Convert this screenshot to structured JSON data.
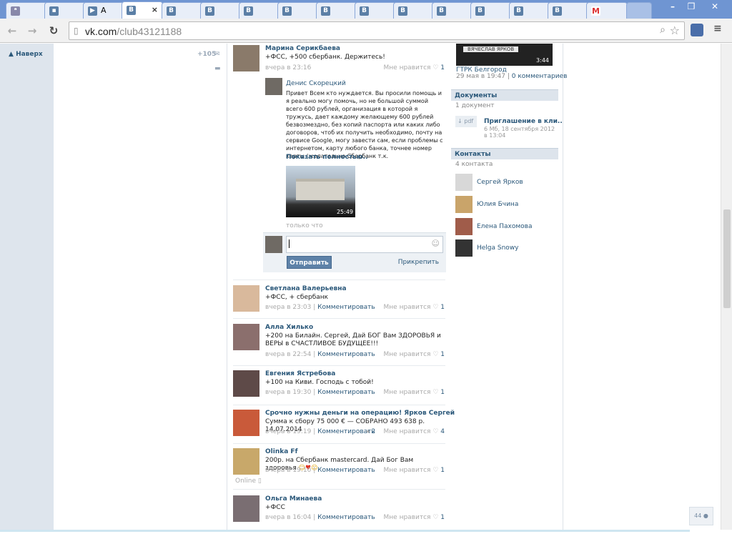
{
  "browser": {
    "tabs": [
      {
        "icon": "vk-icon",
        "label": ""
      },
      {
        "icon": "message-icon",
        "label": ""
      },
      {
        "icon": "play-icon",
        "label": "А"
      },
      {
        "icon": "vk-icon",
        "label": "",
        "active": true
      },
      {
        "icon": "vk-icon",
        "label": ""
      },
      {
        "icon": "vk-icon",
        "label": ""
      },
      {
        "icon": "vk-icon",
        "label": ""
      },
      {
        "icon": "vk-icon",
        "label": ""
      },
      {
        "icon": "vk-icon",
        "label": ""
      },
      {
        "icon": "vk-icon",
        "label": ""
      },
      {
        "icon": "vk-icon",
        "label": ""
      },
      {
        "icon": "vk-icon",
        "label": ""
      },
      {
        "icon": "vk-icon",
        "label": ""
      },
      {
        "icon": "vk-icon",
        "label": ""
      },
      {
        "icon": "vk-icon",
        "label": ""
      },
      {
        "icon": "gmail-icon",
        "label": "M"
      }
    ],
    "url_host": "vk.com",
    "url_path": "/club43121188"
  },
  "sidebar": {
    "back_to_top": "Наверх",
    "count": "+105"
  },
  "main": {
    "reply_button": "Отправить",
    "attach_link": "Прикрепить",
    "posts": [
      {
        "name": "Марина Серикбаева",
        "text": "+ФСС, +500 сбербанк. Держитесь!",
        "time": "вчера в 23:16",
        "likes_label": "Мне нравится",
        "likes": "1"
      },
      {
        "name": "Светлана Валерьевна",
        "text": "+ФСС, + сбербанк",
        "time": "вчера в 23:03",
        "comment": "Комментировать",
        "likes_label": "Мне нравится",
        "likes": "1"
      },
      {
        "name": "Алла Хилько",
        "text": "+200 на Билайн. Сергей, Дай БОГ Вам ЗДОРОВЬЯ и ВЕРЫ в СЧАСТЛИВОЕ БУДУЩЕЕ!!!",
        "time": "вчера в 22:54",
        "comment": "Комментировать",
        "likes_label": "Мне нравится",
        "likes": "1"
      },
      {
        "name": "Евгения Ястребова",
        "text": "+100 на Киви. Господь с тобой!",
        "time": "вчера в 19:30",
        "comment": "Комментировать",
        "likes_label": "Мне нравится",
        "likes": "1"
      },
      {
        "name": "Срочно нужны деньги на операцию! Ярков Сергей",
        "text": "Сумма к сбору 75 000 € — СОБРАНО 493 638 р. 14.07.2014",
        "time": "вчера в 19:19",
        "comment": "Комментировать",
        "shares": "2",
        "likes_label": "Мне нравится",
        "likes": "4"
      },
      {
        "name": "Olinka Ff",
        "text": "200р. на Сбербанк mastercard. Дай Бог Вам здоровья",
        "time": "вчера в 19:10",
        "comment": "Комментировать",
        "likes_label": "Мне нравится",
        "likes": "1",
        "online": "Online"
      },
      {
        "name": "Ольга Минаева",
        "text": "+ФСС",
        "time": "вчера в 16:04",
        "comment": "Комментировать",
        "likes_label": "Мне нравится",
        "likes": "1"
      }
    ],
    "reply": {
      "name": "Денис Скорецкий",
      "text": "Привет Всем кто нуждается. Вы просили помощь и я реально могу помочь, но не большой суммой всего 600 рублей, организация в которой я тружусь, дает каждому желающему 600 рублей безвозмездно, без копий паспорта или каких либо договоров, чтоб их получить необходимо, почту на сервисе Google, могу завести сам, если проблемы с интернетом, карту любого банка, точнее номер карты (желательно Сбербанк т.к.",
      "show_more": "Показать полностью..",
      "video_duration": "25:49",
      "time": "только что"
    }
  },
  "right": {
    "video_caption": "ВЯЧЕСЛАВ ЯРКОВ",
    "video_duration": "3:44",
    "video_source": "ГТРК Белгород",
    "video_date": "29 мая в 19:47",
    "video_comments": "0 комментариев",
    "docs_title": "Документы",
    "docs_count": "1 документ",
    "doc_ext": "pdf",
    "doc_name": "Приглашение в кли..",
    "doc_meta": "6 Мб, 18 сентября 2012 в 13:04",
    "contacts_title": "Контакты",
    "contacts_count": "4 контакта",
    "contacts": [
      "Сергей Ярков",
      "Юлия Бчина",
      "Елена Пахомова",
      "Helga Snowy"
    ]
  },
  "corner_badge": "44"
}
